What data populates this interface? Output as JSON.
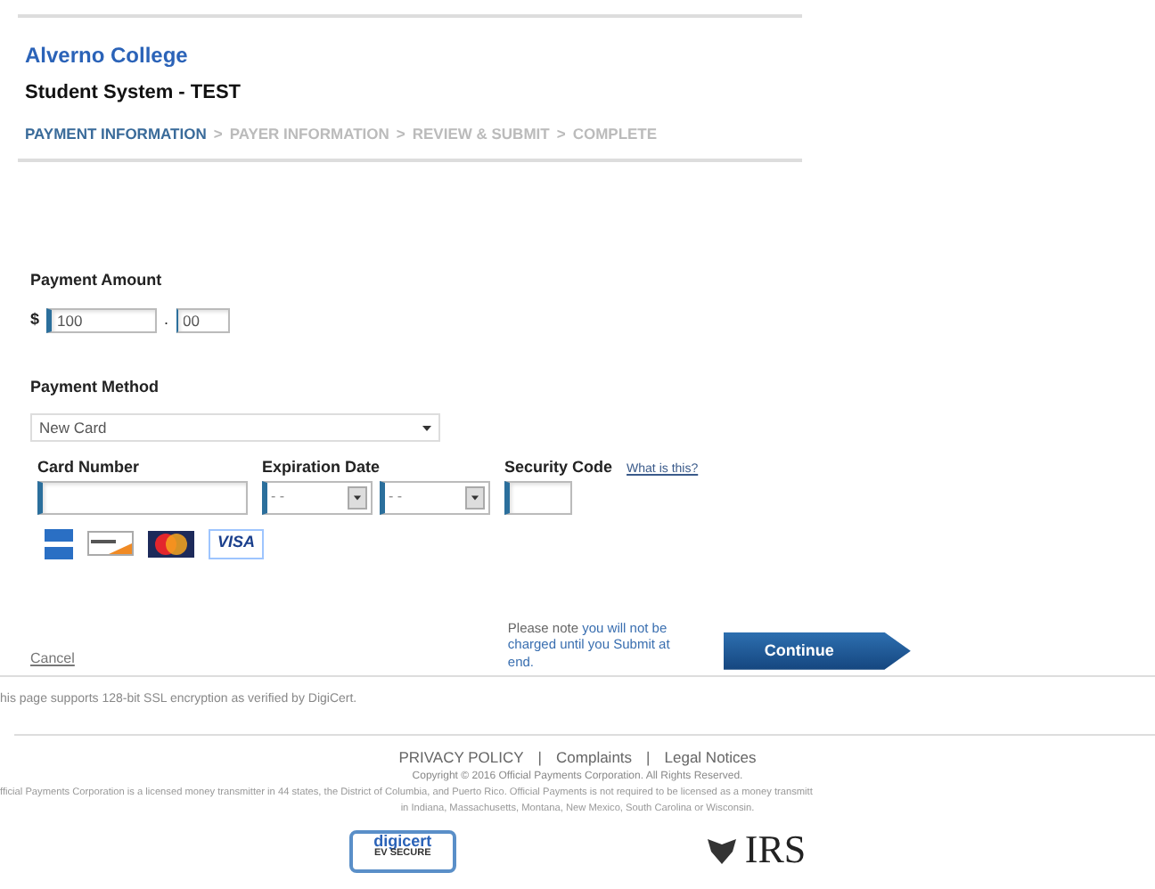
{
  "header": {
    "college": "Alverno College",
    "system": "Student System - TEST"
  },
  "steps": [
    {
      "label": "PAYMENT INFORMATION",
      "selected": true
    },
    {
      "label": "PAYER INFORMATION",
      "selected": false
    },
    {
      "label": "REVIEW & SUBMIT",
      "selected": false
    },
    {
      "label": "COMPLETE",
      "selected": false
    }
  ],
  "step_separator": ">",
  "payment_amount": {
    "label": "Payment Amount",
    "currency": "$",
    "dollars": "100",
    "dot": ".",
    "cents": "00"
  },
  "payment_method": {
    "label": "Payment Method",
    "value": "New Card"
  },
  "card": {
    "number_label": "Card Number",
    "expiration_label": "Expiration Date",
    "month": "- -",
    "year": "- -",
    "security_label": "Security Code",
    "security_help": "What is this?"
  },
  "card_brands": [
    {
      "kind": "amex"
    },
    {
      "kind": "discover"
    },
    {
      "kind": "mastercard"
    },
    {
      "kind": "visa",
      "label": "VISA"
    }
  ],
  "cancel": "Cancel",
  "note": "Please note **you will not be charged until you Submit at end.**",
  "continue": "Continue",
  "ssl_note": "his page supports 128-bit SSL encryption as verified by DigiCert.",
  "footer_links": [
    "PRIVACY POLICY",
    "Complaints",
    "Legal Notices"
  ],
  "footer_separator": "|",
  "copyright": "Copyright © 2016 Official Payments Corporation. All Rights Reserved.",
  "license_line1": "fficial Payments Corporation is a licensed money transmitter in 44 states, the District of Columbia, and Puerto Rico. Official Payments is not required to be licensed as a money transmitt",
  "license_line2": "in Indiana, Massachusetts, Montana, New Mexico, South Carolina or Wisconsin.",
  "digicert": {
    "name": "digicert",
    "sub": "EV SECURE"
  },
  "irs": "IRS"
}
